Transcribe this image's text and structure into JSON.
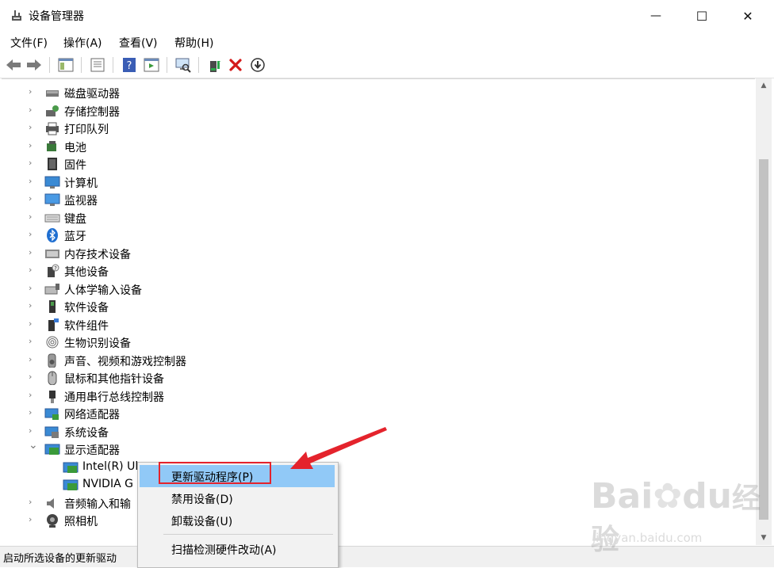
{
  "window": {
    "title": "设备管理器",
    "minimize_glyph": "—",
    "maximize_glyph": "☐",
    "close_glyph": "✕"
  },
  "menu": [
    "文件(F)",
    "操作(A)",
    "查看(V)",
    "帮助(H)"
  ],
  "toolbar_icons": [
    "back-icon",
    "forward-icon",
    "show-hide-tree-icon",
    "properties-icon",
    "help-icon",
    "action-pane-icon",
    "scan-hardware-icon",
    "update-driver-icon",
    "uninstall-icon",
    "download-icon"
  ],
  "tree": {
    "categories": [
      {
        "label": "磁盘驱动器",
        "icon": "disk-drive-icon",
        "expanded": false
      },
      {
        "label": "存储控制器",
        "icon": "storage-controller-icon",
        "expanded": false
      },
      {
        "label": "打印队列",
        "icon": "printer-icon",
        "expanded": false
      },
      {
        "label": "电池",
        "icon": "battery-icon",
        "expanded": false
      },
      {
        "label": "固件",
        "icon": "firmware-icon",
        "expanded": false
      },
      {
        "label": "计算机",
        "icon": "computer-icon",
        "expanded": false
      },
      {
        "label": "监视器",
        "icon": "monitor-icon",
        "expanded": false
      },
      {
        "label": "键盘",
        "icon": "keyboard-icon",
        "expanded": false
      },
      {
        "label": "蓝牙",
        "icon": "bluetooth-icon",
        "expanded": false
      },
      {
        "label": "内存技术设备",
        "icon": "memory-device-icon",
        "expanded": false
      },
      {
        "label": "其他设备",
        "icon": "other-device-icon",
        "expanded": false
      },
      {
        "label": "人体学输入设备",
        "icon": "hid-icon",
        "expanded": false
      },
      {
        "label": "软件设备",
        "icon": "software-device-icon",
        "expanded": false
      },
      {
        "label": "软件组件",
        "icon": "software-component-icon",
        "expanded": false
      },
      {
        "label": "生物识别设备",
        "icon": "fingerprint-icon",
        "expanded": false
      },
      {
        "label": "声音、视频和游戏控制器",
        "icon": "speaker-icon",
        "expanded": false
      },
      {
        "label": "鼠标和其他指针设备",
        "icon": "mouse-icon",
        "expanded": false
      },
      {
        "label": "通用串行总线控制器",
        "icon": "usb-icon",
        "expanded": false
      },
      {
        "label": "网络适配器",
        "icon": "network-adapter-icon",
        "expanded": false
      },
      {
        "label": "系统设备",
        "icon": "system-device-icon",
        "expanded": false
      },
      {
        "label": "显示适配器",
        "icon": "display-adapter-icon",
        "expanded": true
      }
    ],
    "display_children": [
      "Intel(R) Ul",
      "NVIDIA G"
    ],
    "after": [
      {
        "label": "音频输入和输",
        "icon": "audio-input-icon",
        "expanded": false
      },
      {
        "label": "照相机",
        "icon": "camera-icon",
        "expanded": false
      }
    ]
  },
  "context_menu": {
    "items": [
      "更新驱动程序(P)",
      "禁用设备(D)",
      "卸载设备(U)",
      "扫描检测硬件改动(A)"
    ],
    "highlighted_index": 0
  },
  "status": "启动所选设备的更新驱动",
  "watermark": {
    "main": "Bai",
    "paw": "du",
    "suffix": "经验",
    "url": "jingyan.baidu.com"
  },
  "colors": {
    "highlight": "#91c9f7",
    "annotation_red": "#e4232c",
    "accent": "#0078d7"
  }
}
